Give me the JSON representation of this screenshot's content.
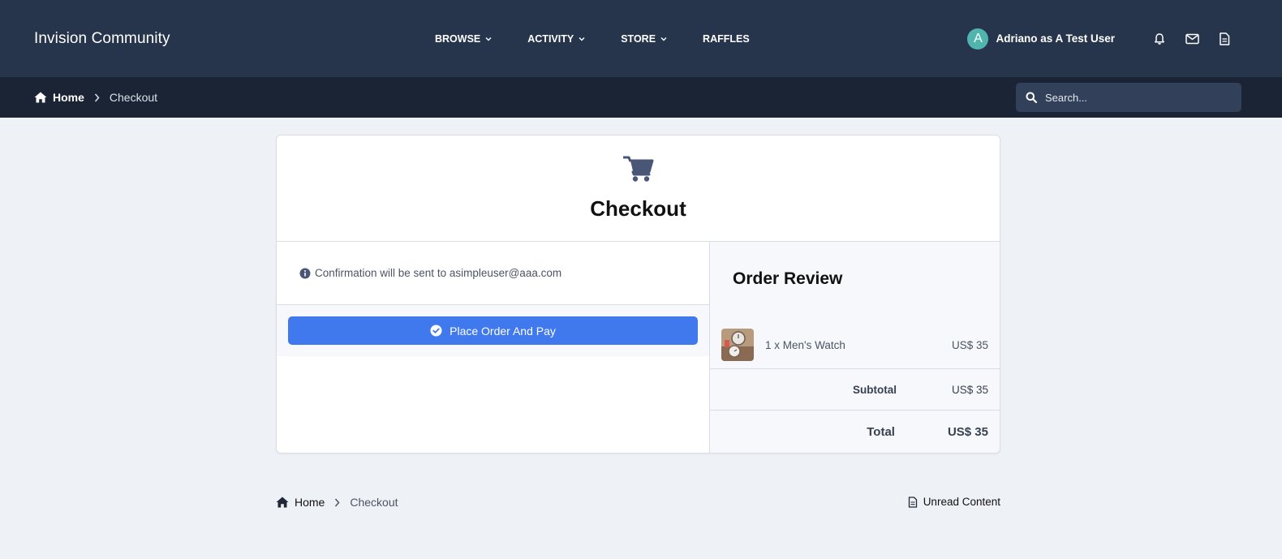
{
  "header": {
    "site_title": "Invision Community",
    "nav": [
      {
        "label": "BROWSE",
        "has_dropdown": true
      },
      {
        "label": "ACTIVITY",
        "has_dropdown": true
      },
      {
        "label": "STORE",
        "has_dropdown": true
      },
      {
        "label": "RAFFLES",
        "has_dropdown": false
      }
    ],
    "user": {
      "avatar_letter": "A",
      "name": "Adriano as A Test User",
      "avatar_color": "#4fb5ad"
    },
    "icons": [
      "bell-icon",
      "envelope-icon",
      "document-icon"
    ]
  },
  "breadcrumb": {
    "home": "Home",
    "current": "Checkout"
  },
  "search": {
    "placeholder": "Search..."
  },
  "checkout": {
    "title": "Checkout",
    "confirmation": "Confirmation will be sent to asimpleuser@aaa.com",
    "place_order_label": "Place Order And Pay",
    "order_review": {
      "title": "Order Review",
      "items": [
        {
          "name": "1 x Men's Watch",
          "price": "US$ 35"
        }
      ],
      "subtotal_label": "Subtotal",
      "subtotal_value": "US$ 35",
      "total_label": "Total",
      "total_value": "US$ 35"
    }
  },
  "footer": {
    "home": "Home",
    "current": "Checkout",
    "unread_label": "Unread Content"
  },
  "colors": {
    "header_bg": "#27354c",
    "subbar_bg": "#1b2435",
    "accent": "#4078ee",
    "page_bg": "#eef1f6"
  }
}
